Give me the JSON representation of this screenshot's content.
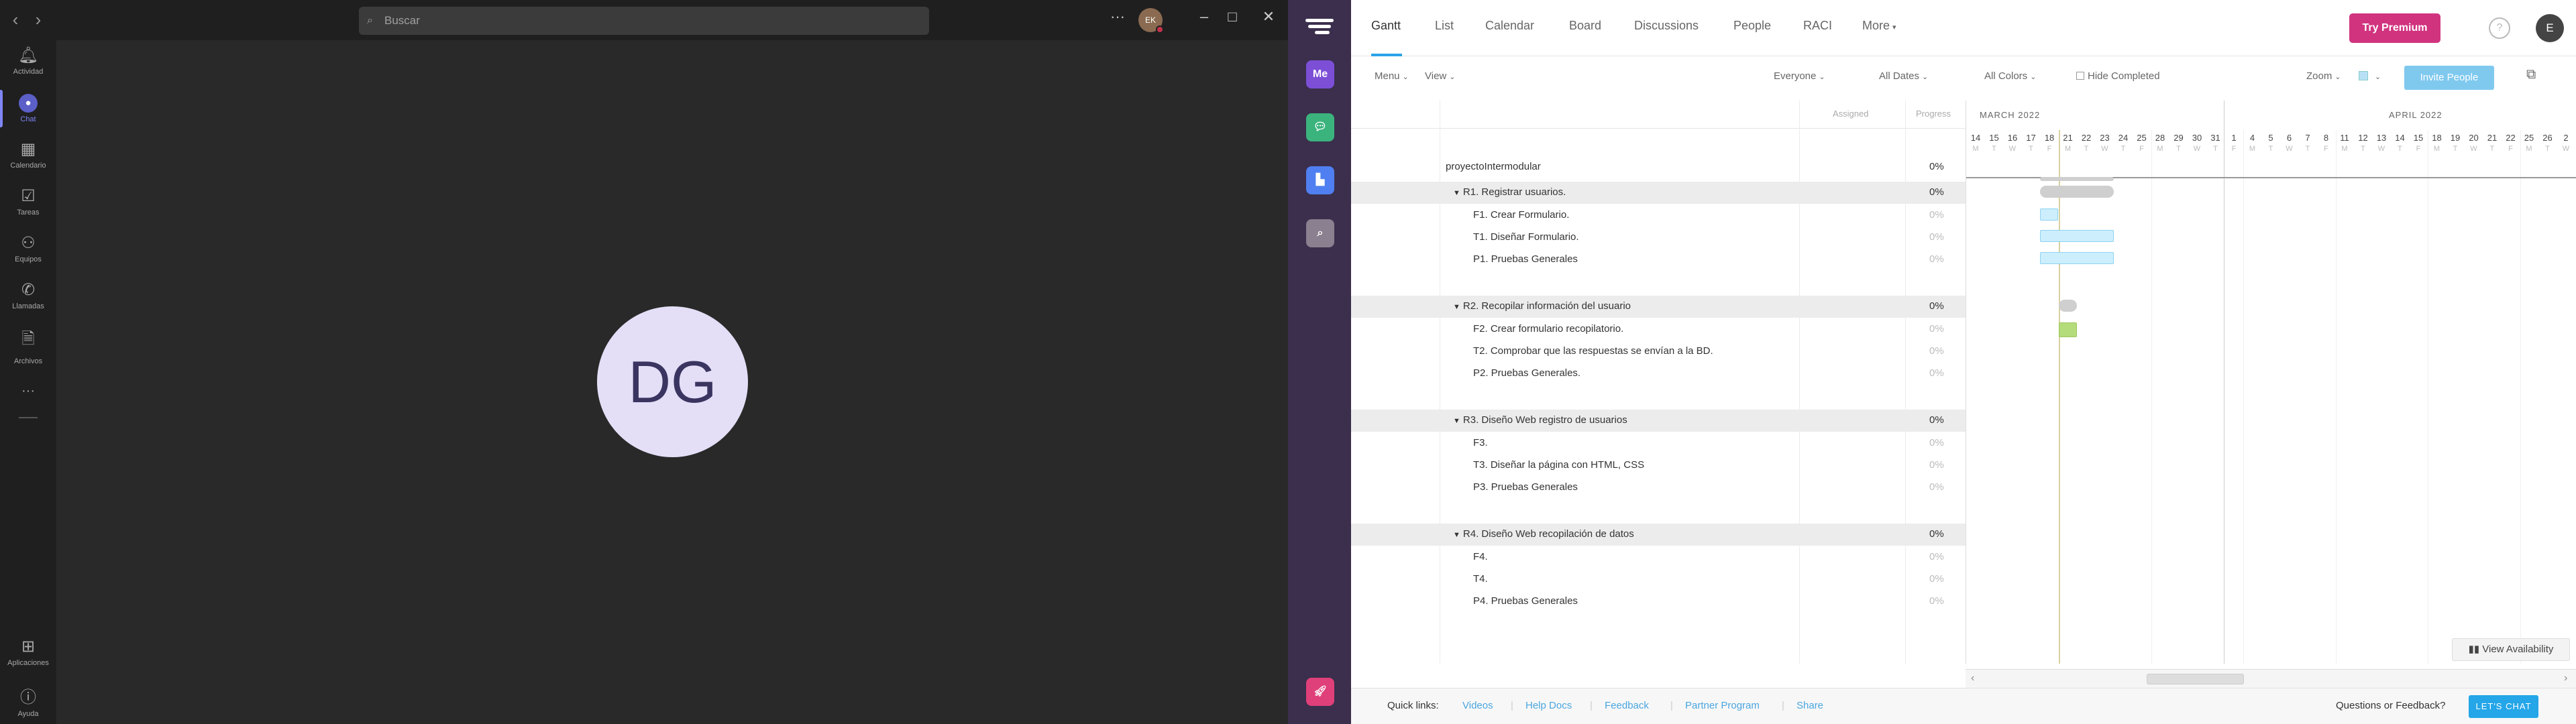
{
  "teams": {
    "search_placeholder": "Buscar",
    "avatar": "EK",
    "dots": "···",
    "profile": "DG",
    "rail": [
      "Actividad",
      "Chat",
      "Calendario",
      "Tareas",
      "Equipos",
      "Llamadas",
      "Archivos",
      "Aplicaciones",
      "Ayuda"
    ],
    "more": "···"
  },
  "app": {
    "tabs": [
      "Gantt",
      "List",
      "Calendar",
      "Board",
      "Discussions",
      "People",
      "RACI",
      "More"
    ],
    "premium": "Try Premium",
    "user_initial": "E",
    "me": "Me",
    "toolbar": {
      "menu": "Menu",
      "view": "View",
      "everyone": "Everyone",
      "all_dates": "All Dates",
      "all_colors": "All Colors",
      "hide_completed": "Hide Completed",
      "zoom": "Zoom",
      "invite": "Invite People"
    },
    "columns": {
      "assigned": "Assigned",
      "progress": "Progress"
    },
    "project": {
      "name": "proyectoIntermodular",
      "progress": "0%"
    },
    "groups": [
      {
        "title": "R1. Registrar usuarios.",
        "progress": "0%",
        "tasks": [
          {
            "name": "F1. Crear Formulario.",
            "progress": "0%"
          },
          {
            "name": "T1. Diseñar Formulario.",
            "progress": "0%"
          },
          {
            "name": "P1. Pruebas Generales",
            "progress": "0%"
          }
        ]
      },
      {
        "title": "R2. Recopilar información del usuario",
        "progress": "0%",
        "tasks": [
          {
            "name": "F2. Crear formulario recopilatorio.",
            "progress": "0%"
          },
          {
            "name": "T2. Comprobar que las respuestas se envían a la BD.",
            "progress": "0%"
          },
          {
            "name": "P2. Pruebas Generales.",
            "progress": "0%"
          }
        ]
      },
      {
        "title": "R3. Diseño Web registro de usuarios",
        "progress": "0%",
        "tasks": [
          {
            "name": "F3.",
            "progress": "0%"
          },
          {
            "name": "T3. Diseñar la página con HTML, CSS",
            "progress": "0%"
          },
          {
            "name": "P3. Pruebas Generales",
            "progress": "0%"
          }
        ]
      },
      {
        "title": "R4. Diseño Web recopilación de datos",
        "progress": "0%",
        "tasks": [
          {
            "name": "F4.",
            "progress": "0%"
          },
          {
            "name": "T4.",
            "progress": "0%"
          },
          {
            "name": "P4. Pruebas Generales",
            "progress": "0%"
          }
        ]
      }
    ],
    "gantt": {
      "months": [
        "MARCH 2022",
        "APRIL 2022"
      ],
      "days": [
        "14",
        "15",
        "16",
        "17",
        "18",
        "21",
        "22",
        "23",
        "24",
        "25",
        "28",
        "29",
        "30",
        "31",
        "1",
        "4",
        "5",
        "6",
        "7",
        "8",
        "11",
        "12",
        "13",
        "14",
        "15",
        "18",
        "19",
        "20",
        "21",
        "22",
        "25",
        "26",
        "2"
      ],
      "weekdays": [
        "M",
        "T",
        "W",
        "T",
        "F",
        "M",
        "T",
        "W",
        "T",
        "F",
        "M",
        "T",
        "W",
        "T",
        "F",
        "M",
        "T",
        "W",
        "T",
        "F",
        "M",
        "T",
        "W",
        "T",
        "F",
        "M",
        "T",
        "W",
        "T",
        "F",
        "M",
        "T",
        "W"
      ],
      "view_availability": "View Availability"
    },
    "footer": {
      "quick_links": "Quick links:",
      "links": [
        "Videos",
        "Help Docs",
        "Feedback",
        "Partner Program",
        "Share"
      ],
      "question": "Questions or Feedback?",
      "chat": "LET'S CHAT"
    },
    "colors": {
      "sidebar": "#3b2f4d",
      "premium": "#d1337f",
      "accent": "#2aa2e8"
    }
  }
}
